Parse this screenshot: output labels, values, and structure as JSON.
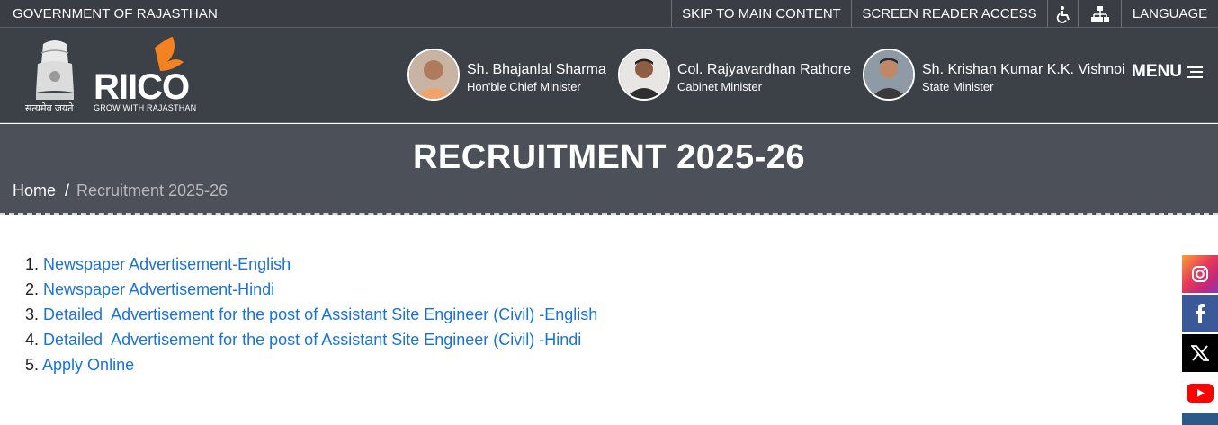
{
  "topbar": {
    "government": "GOVERNMENT OF RAJASTHAN",
    "skip": "SKIP TO MAIN CONTENT",
    "screen_reader": "SCREEN READER ACCESS",
    "language": "LANGUAGE",
    "icons": [
      "accessibility-icon",
      "sitemap-icon"
    ]
  },
  "header": {
    "emblem_motto": "सत्यमेव जयते",
    "logo_text": "RIICO",
    "logo_tagline": "GROW WITH RAJASTHAN",
    "ministers": [
      {
        "name": "Sh. Bhajanlal Sharma",
        "role": "Hon'ble Chief Minister"
      },
      {
        "name": "Col. Rajyavardhan Rathore",
        "role": "Cabinet Minister"
      },
      {
        "name": "Sh. Krishan Kumar K.K. Vishnoi",
        "role": "State Minister"
      }
    ],
    "menu": "MENU"
  },
  "banner": {
    "title": "RECRUITMENT 2025-26",
    "breadcrumb_home": "Home",
    "breadcrumb_sep": "/",
    "breadcrumb_current": "Recruitment 2025-26"
  },
  "content": {
    "items": [
      {
        "num": "1.",
        "label": "Newspaper Advertisement-English"
      },
      {
        "num": "2.",
        "label": "Newspaper Advertisement-Hindi"
      },
      {
        "num": "3.",
        "label": "Detailed  Advertisement for the post of Assistant Site Engineer (Civil) -English"
      },
      {
        "num": "4.",
        "label": "Detailed  Advertisement for the post of Assistant Site Engineer (Civil) -Hindi"
      },
      {
        "num": "5.",
        "label": "Apply Online"
      }
    ]
  },
  "social": {
    "icons": [
      "instagram-icon",
      "facebook-icon",
      "x-icon",
      "youtube-icon"
    ]
  },
  "colors": {
    "topbar": "#3a3d44",
    "header": "#3c4047",
    "banner": "#4c5058",
    "link": "#1a73d9",
    "logo_accent": "#f58220"
  }
}
